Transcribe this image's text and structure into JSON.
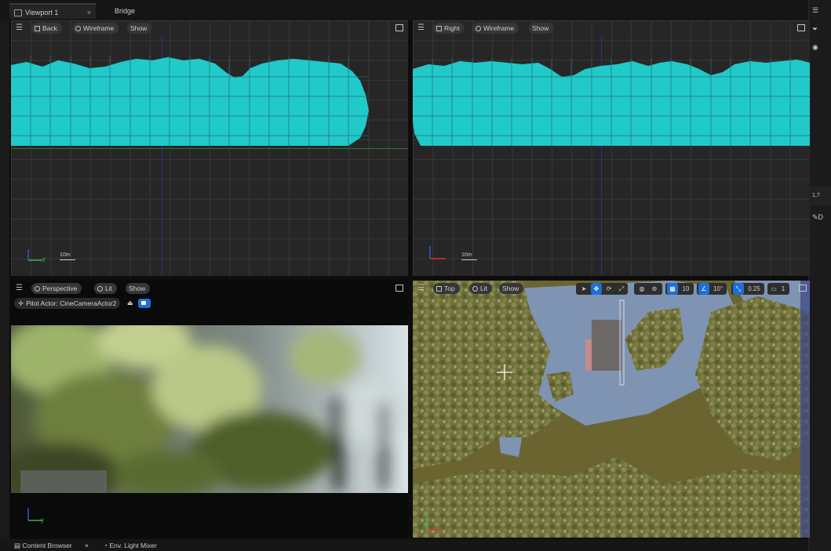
{
  "tabs": {
    "viewport_tab": "Viewport 1",
    "close_glyph": "×",
    "bridge_tab": "Bridge"
  },
  "right_dock": {
    "value_partial": "1,7",
    "item_partial": "D"
  },
  "viewport_back": {
    "view_label": "Back",
    "mode_label": "Wireframe",
    "show_label": "Show",
    "axis_label": "y",
    "scale_label": "10m"
  },
  "viewport_right": {
    "view_label": "Right",
    "mode_label": "Wireframe",
    "show_label": "Show",
    "scale_label": "10m"
  },
  "viewport_perspective": {
    "view_label": "Perspective",
    "mode_label": "Lit",
    "show_label": "Show",
    "pilot_label": "Pilot Actor: CineCameraActor2",
    "axis_label": "y"
  },
  "viewport_top": {
    "view_label": "Top",
    "mode_label": "Lit",
    "show_label": "Show",
    "grid_snap": "10",
    "rotation_snap": "10°",
    "scale_snap": "0.25",
    "camera_speed": "1"
  },
  "bottom_tabs": {
    "content_browser": "Content Browser",
    "close_glyph": "×",
    "env_light_mixer": "Env. Light Mixer"
  },
  "colors": {
    "wireframe_foliage": "#22c9c9",
    "selected_blue": "#1e6fd9",
    "ground_olive": "#6b6430",
    "water_blue": "#7f93b3"
  }
}
